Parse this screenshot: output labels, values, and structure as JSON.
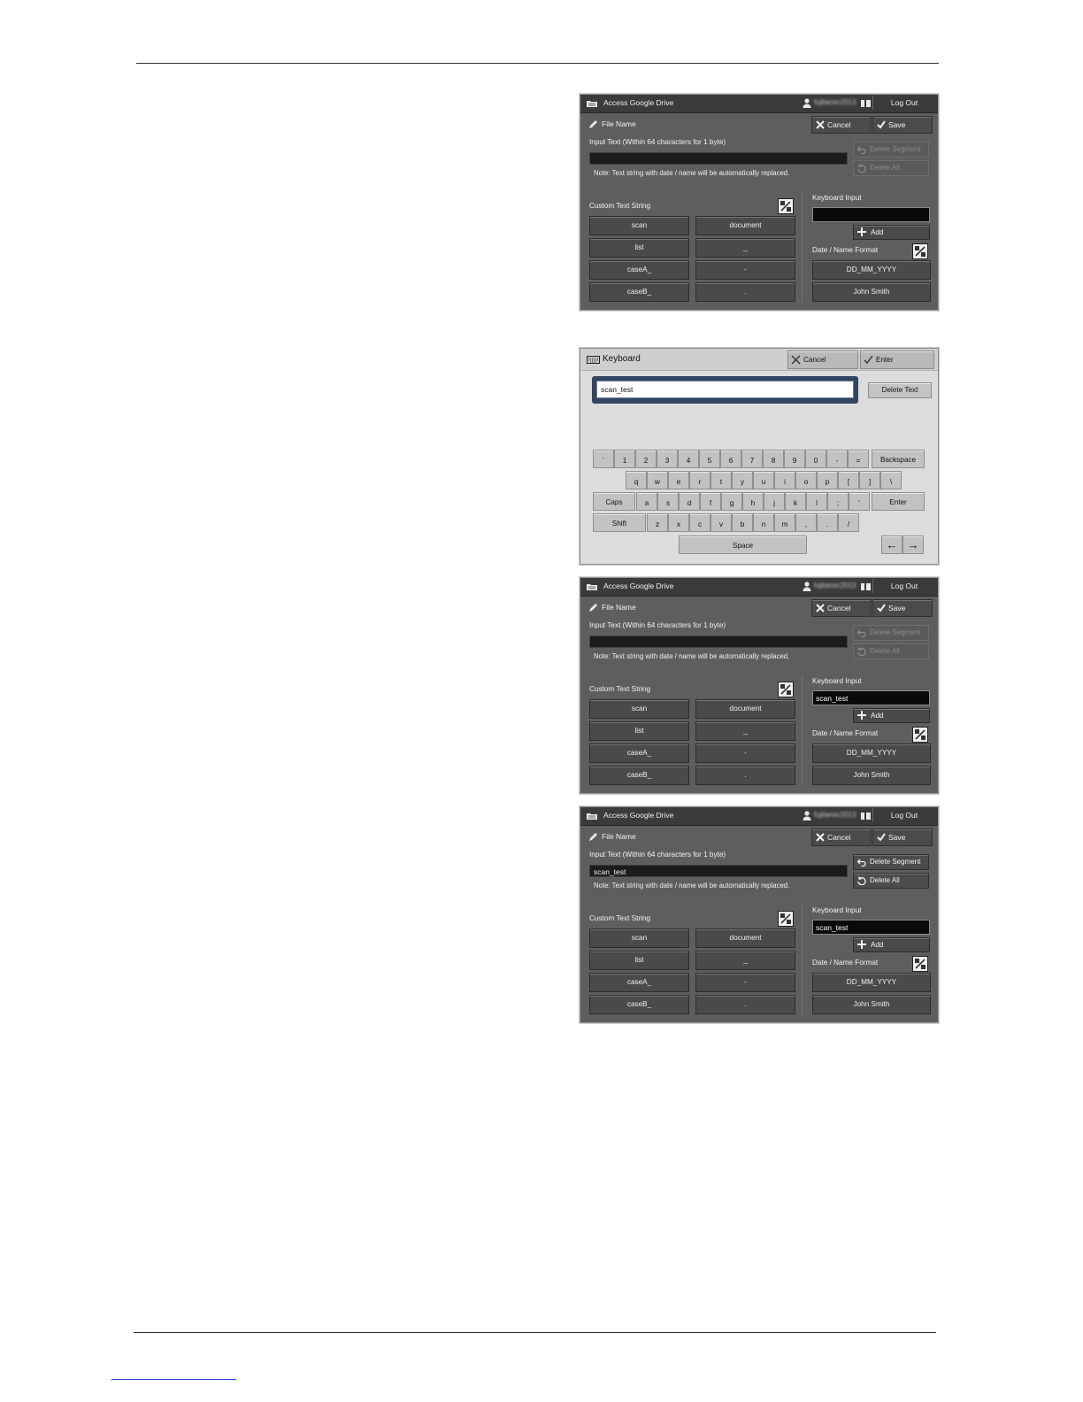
{
  "file_name_screen": {
    "header_title": "Access Google Drive",
    "user_name": "fujitanoc2013",
    "logout": "Log Out",
    "section_title": "File Name",
    "cancel": "Cancel",
    "save": "Save",
    "input_label": "Input Text (Within 64 characters for 1 byte)",
    "note": "Note: Text string with date / name will be automatically replaced.",
    "delete_segment": "Delete Segment",
    "delete_all": "Delete All",
    "custom_label": "Custom Text String",
    "custom_items": [
      "scan",
      "document",
      "list",
      "_",
      "caseA_",
      "-",
      "caseB_",
      "."
    ],
    "keyboard_input_label": "Keyboard Input",
    "add": "Add",
    "date_name_label": "Date / Name Format",
    "date_format": "DD_MM_YYYY",
    "name_format": "John Smith"
  },
  "screens": [
    {
      "input_text": "",
      "keyboard_input": "",
      "delete_enabled": false
    },
    {
      "input_text": "",
      "keyboard_input": "scan_test",
      "delete_enabled": false
    },
    {
      "input_text": "scan_test",
      "keyboard_input": "scan_test",
      "delete_enabled": true
    }
  ],
  "keyboard_screen": {
    "title": "Keyboard",
    "cancel": "Cancel",
    "enter": "Enter",
    "text_value": "scan_test",
    "delete_text": "Delete Text",
    "row1": [
      "`",
      "1",
      "2",
      "3",
      "4",
      "5",
      "6",
      "7",
      "8",
      "9",
      "0",
      "-",
      "="
    ],
    "backspace": "Backspace",
    "row2": [
      "q",
      "w",
      "e",
      "r",
      "t",
      "y",
      "u",
      "i",
      "o",
      "p",
      "[",
      "]",
      "\\"
    ],
    "caps": "Caps",
    "row3": [
      "a",
      "s",
      "d",
      "f",
      "g",
      "h",
      "j",
      "k",
      "l",
      ";",
      "'"
    ],
    "enter_key": "Enter",
    "shift": "Shift",
    "row4": [
      "z",
      "x",
      "c",
      "v",
      "b",
      "n",
      "m",
      ",",
      ".",
      "/"
    ],
    "space": "Space",
    "left_arrow": "←",
    "right_arrow": "→"
  }
}
